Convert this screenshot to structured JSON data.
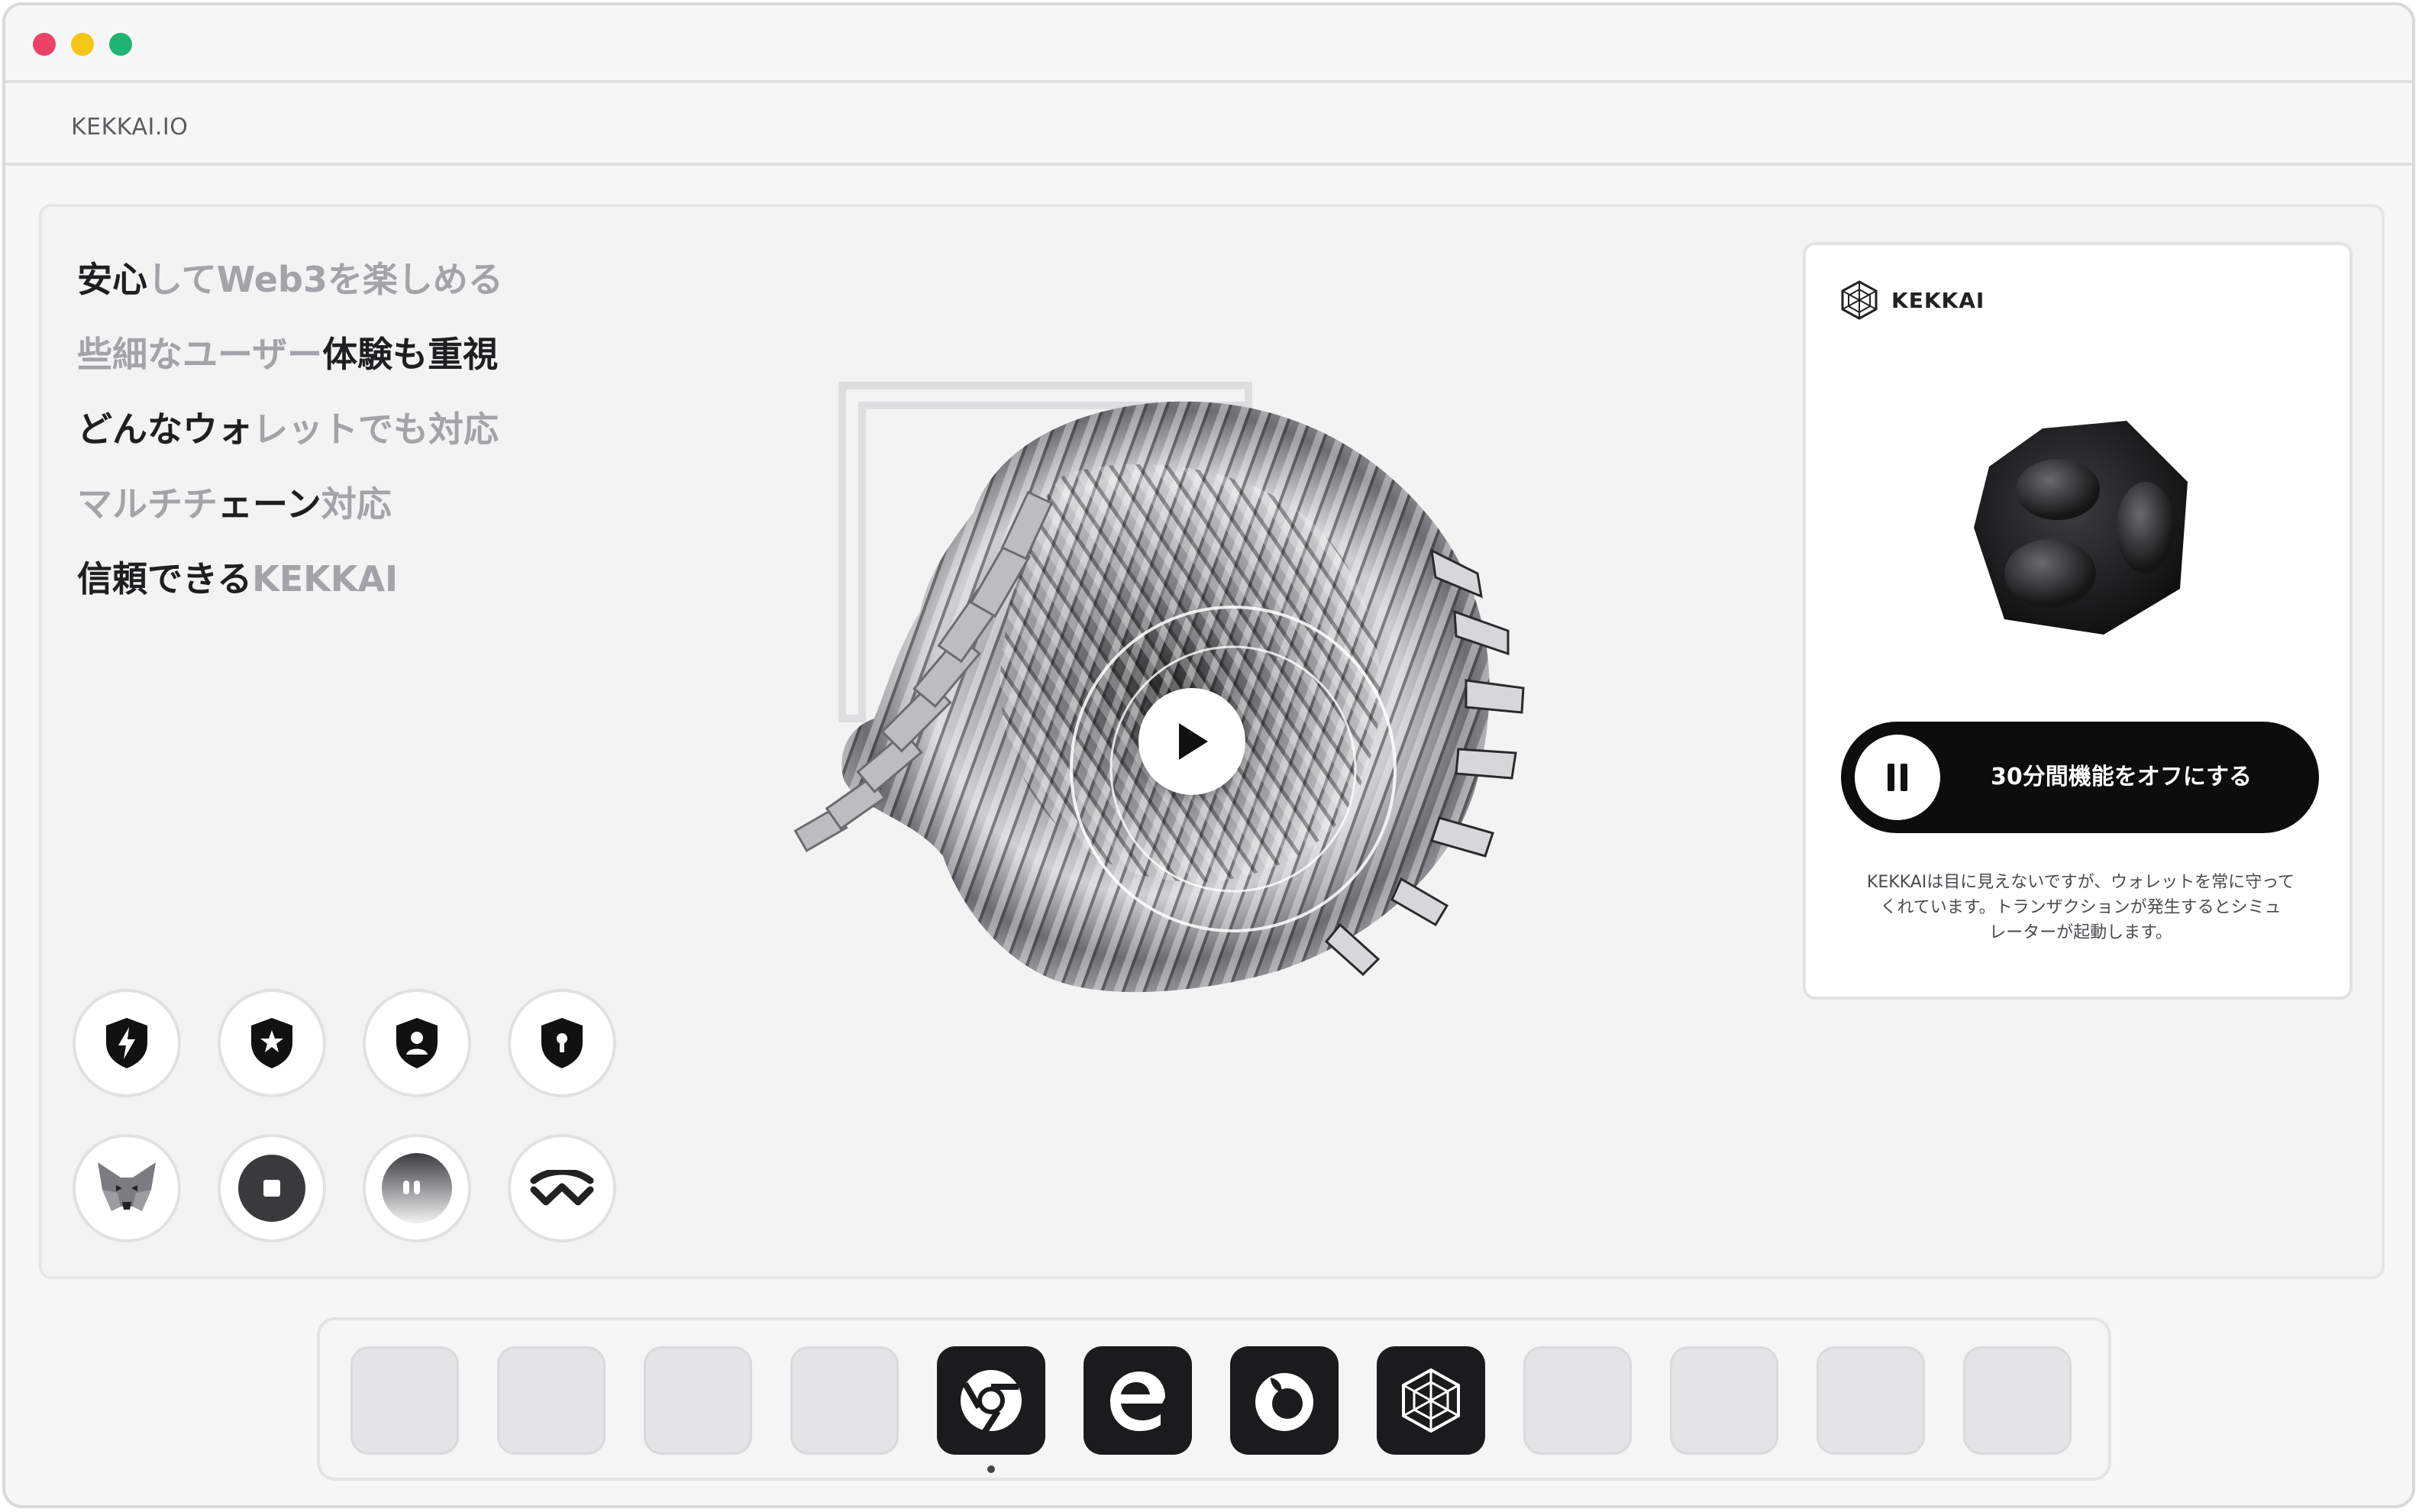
{
  "window": {
    "controls": [
      "close",
      "minimize",
      "maximize"
    ],
    "colors": {
      "close": "#ec4169",
      "minimize": "#f5c518",
      "maximize": "#1fb472"
    }
  },
  "urlbar": {
    "site": "KEKKAI.IO"
  },
  "features": [
    {
      "dark": "安心",
      "light": "してWeb3を楽しめる"
    },
    {
      "light": "些細なユーザー",
      "dark": "体験も重視"
    },
    {
      "dark": "どんなウォ",
      "light": "レットでも対応"
    },
    {
      "light": "マルチチ",
      "dark": "ェーン",
      "light2": "対応"
    },
    {
      "dark": "信頼できる",
      "light": "KEKKAI"
    }
  ],
  "badges": {
    "security": [
      "bolt-shield-icon",
      "star-shield-icon",
      "user-shield-icon",
      "keyhole-shield-icon"
    ],
    "wallets": [
      "metamask-icon",
      "stop-wallet-icon",
      "ghost-wallet-icon",
      "walletconnect-icon"
    ]
  },
  "card": {
    "brand": "KEKKAI",
    "toggle_label": "30分間機能をオフにする",
    "description_line1": "KEKKAIは目に見えないですが、ウォレットを常に守って",
    "description_line2": "くれています。トランザクションが発生するとシミュ",
    "description_line3": "レーターが起動します。"
  },
  "dock": {
    "items": [
      "empty",
      "empty",
      "empty",
      "empty",
      "chrome-icon",
      "edge-icon",
      "firefox-icon",
      "kekkai-icon",
      "empty",
      "empty",
      "empty",
      "empty"
    ],
    "active_index": 4
  }
}
